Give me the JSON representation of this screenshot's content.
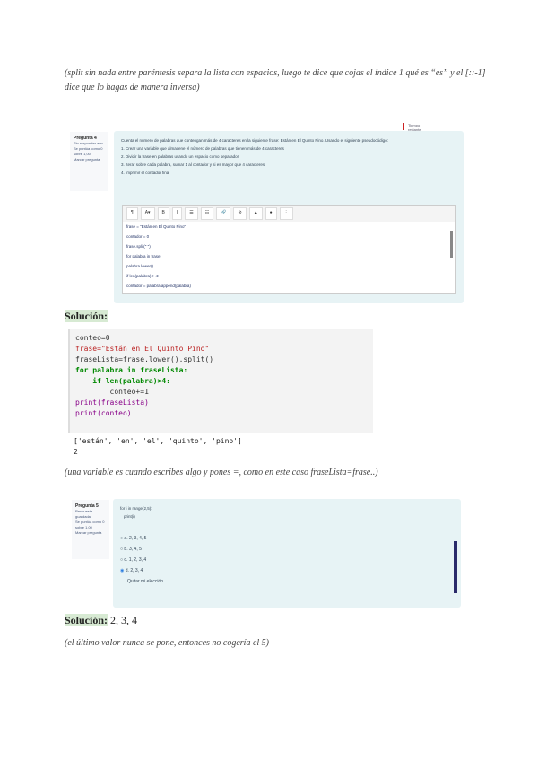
{
  "notes": {
    "split_note": "(split sin nada entre paréntesis separa la lista con espacios, luego te dice que cojas el índice 1 qué es “es” y el [::-1] dice que lo hagas de manera inversa)",
    "variable_note": "(una variable es cuando escribes algo y pones =, como en este caso fraseLista=frase..)",
    "range_note": "(el último valor nunca se pone, entonces no cogería el 5)"
  },
  "question4": {
    "info_title": "Pregunta 4",
    "info_status": "Sin responder aún",
    "info_points": "Se puntúa como 0 sobre 1,00",
    "info_flag": "Marcar pregunta",
    "header_note": "Tiempo restante",
    "lines": [
      "Cuenta el número de palabras que contengan más de 4 caracteres en la siguiente frase: Están en El Quinto Pino. Usando el siguiente pseudocódigo:",
      "1. Crear una variable que almacene el número de palabras que tienen más de 4 caracteres",
      "2. Dividir la frase en palabras usando un espacio como separador",
      "3. Iterar sobre cada palabra, sumar 1 al contador y si es mayor que 4 caracteres",
      "4. Imprimir el contador final"
    ],
    "toolbar": [
      "¶",
      "A▾",
      "B",
      "I",
      "☰",
      "☷",
      "🔗",
      "⊘",
      "▲",
      "●",
      "⋮"
    ],
    "editor_lines": [
      "frase = \"Están en El Quinto Pino\"",
      "contador = 0",
      "frase.split(\" \")",
      "for palabra in frase:",
      "    palabra.lower()",
      "    if len(palabra) > 4:",
      "        contador = palabra.append(palabra)"
    ]
  },
  "solution4": {
    "label": "Solución:",
    "code": [
      "conteo=0",
      "frase=\"Están en El Quinto Pino\"",
      "",
      "fraseLista=frase.lower().split()",
      "for palabra in fraseLista:",
      "    if len(palabra)>4:",
      "        conteo+=1",
      "print(fraseLista)",
      "print(conteo)"
    ],
    "output": [
      "['están', 'en', 'el', 'quinto', 'pino']",
      "2"
    ]
  },
  "question5": {
    "info_title": "Pregunta 5",
    "info_status": "Respuesta guardada",
    "info_points": "Se puntúa como 0 sobre 1,00",
    "info_flag": "Marcar pregunta",
    "code_lines": [
      "for i in range(2,5):",
      "   print(i)"
    ],
    "options": [
      {
        "label": "a. 2, 3, 4, 5",
        "selected": false
      },
      {
        "label": "b. 3, 4, 5",
        "selected": false
      },
      {
        "label": "c. 1, 2, 3, 4",
        "selected": false
      },
      {
        "label": "d. 2, 3, 4",
        "selected": true
      }
    ],
    "clear": "Quitar mi elección"
  },
  "solution5": {
    "label": "Solución:",
    "value": "2, 3, 4"
  }
}
